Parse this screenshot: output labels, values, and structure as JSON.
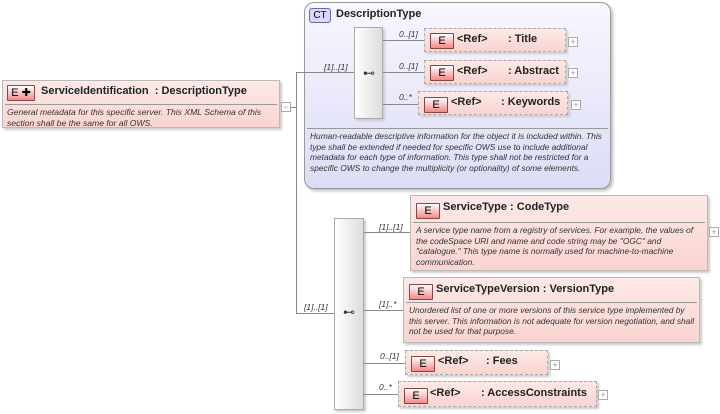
{
  "root": {
    "badge": "E",
    "name": "ServiceIdentification",
    "type": ": DescriptionType",
    "doc": "General metadata for this specific server. This XML Schema of this section shall be the same for all OWS.",
    "collapse": "−"
  },
  "complex_type": {
    "badge": "CT",
    "name": "DescriptionType",
    "cardinality": "[1]..[1]",
    "doc": "Human-readable descriptive information for the object it is included within. This type shall be extended if needed for specific OWS use to include additional metadata for each type of information. This type shall not be restricted for a specific OWS to change the multiplicity (or optionality) of some elements.",
    "children": [
      {
        "badge": "E",
        "ref": "<Ref>",
        "name": ": Title",
        "cardinality": "0..[1]",
        "expand": "+"
      },
      {
        "badge": "E",
        "ref": "<Ref>",
        "name": ": Abstract",
        "cardinality": "0..[1]",
        "expand": "+"
      },
      {
        "badge": "E",
        "ref": "<Ref>",
        "name": ": Keywords",
        "cardinality": "0..*",
        "expand": "+"
      }
    ]
  },
  "sequence2": {
    "cardinality": "[1]..[1]",
    "children": [
      {
        "badge": "E",
        "name": "ServiceType : CodeType",
        "cardinality": "[1]..[1]",
        "doc": "A service type name from a registry of services. For example, the values of the codeSpace URI and name and code string may be \"OGC\" and \"catalogue.\" This type name is normally used for machine-to-machine communication.",
        "expand": "+"
      },
      {
        "badge": "E",
        "name": "ServiceTypeVersion : VersionType",
        "cardinality": "[1]..*",
        "doc": "Unordered list of one or more versions of this service type implemented by this server. This information is not adequate for version negotiation, and shall not be used for that purpose."
      },
      {
        "badge": "E",
        "ref": "<Ref>",
        "name": ": Fees",
        "cardinality": "0..[1]",
        "expand": "+"
      },
      {
        "badge": "E",
        "ref": "<Ref>",
        "name": ": AccessConstraints",
        "cardinality": "0..*",
        "expand": "+"
      }
    ]
  }
}
